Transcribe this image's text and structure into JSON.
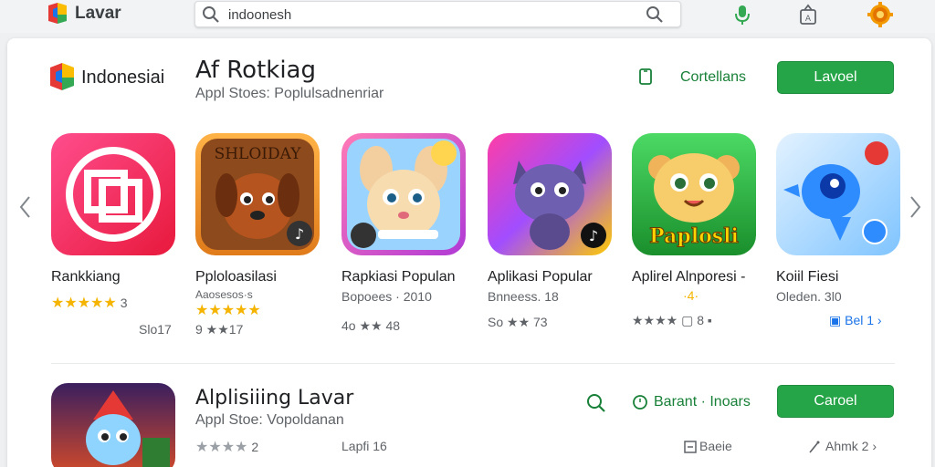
{
  "header": {
    "brand": "Lavar",
    "search_value": "indoonesh"
  },
  "section1": {
    "brand": "Indonesiai",
    "title": "Af Rotkiag",
    "subtitle": "Appl Stoes: Poplulsadnenriar",
    "link_label": "Cortellans",
    "button_label": "Lavoel"
  },
  "apps": [
    {
      "name": "Rankkiang",
      "rating_text": "3",
      "stars": 5,
      "meta": "Slo17"
    },
    {
      "name": "Pploloasilasi",
      "meta_top": "Aaosesos·s",
      "stars": 5,
      "meta": "9 ★★17",
      "icon_text": "SHLOIDAY"
    },
    {
      "name": "Rapkiasi Populan",
      "meta_top": "Bopoees · 2010",
      "meta": "4o ★★ 48"
    },
    {
      "name": "Aplikasi Popular",
      "meta_top": "Bnneess. 18",
      "meta": "So ★★ 73"
    },
    {
      "name": "Aplirel Alnporesi -",
      "meta_top": "·4·",
      "meta": "★★★★ ▢ 8 ▪",
      "icon_text": "Paplosli"
    },
    {
      "name": "Koiil Fiesi",
      "meta_top": "Oleden. 3l0",
      "meta": "▣ Bel 1 ›"
    }
  ],
  "section2": {
    "title": "Alplisiiing Lavar",
    "subtitle": "Appl Stoe: Vopoldanan",
    "rating_num": "2",
    "meta_mid": "Lapfi 16",
    "link_label": "Barant · Inoars",
    "button_label": "Caroel",
    "filter_label": "Baeie",
    "ahmk_label": "Ahmk 2 ›"
  },
  "colors": {
    "accent_green": "#25a547",
    "link_green": "#188038",
    "star": "#f4b400"
  }
}
